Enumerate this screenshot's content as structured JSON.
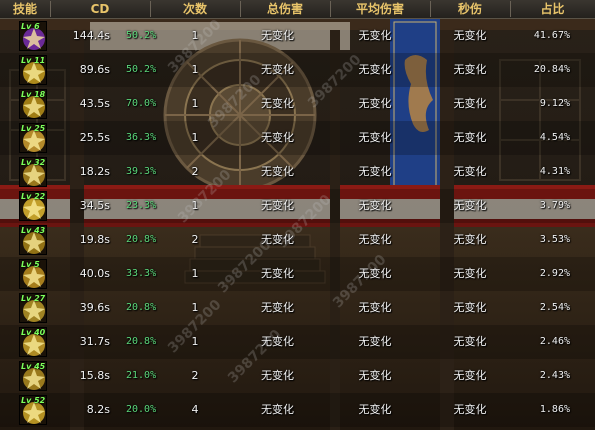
{
  "header": {
    "skill": "技能",
    "cd": "CD",
    "count": "次数",
    "total_damage": "总伤害",
    "avg_damage": "平均伤害",
    "dps": "秒伤",
    "share": "占比"
  },
  "watermark": "3987200",
  "rows": [
    {
      "level": "Lv 6",
      "cd": "144.4s",
      "cd_pct": "50.2%",
      "count": "1",
      "total": "无变化",
      "avg": "无变化",
      "dps": "无变化",
      "share": "41.67%",
      "icon": "purple-blast-icon",
      "color": "#7a2fb0"
    },
    {
      "level": "Lv 11",
      "cd": "89.6s",
      "cd_pct": "50.2%",
      "count": "1",
      "total": "无变化",
      "avg": "无变化",
      "dps": "无变化",
      "share": "20.84%",
      "icon": "golden-arms-icon",
      "color": "#c8a020"
    },
    {
      "level": "Lv 18",
      "cd": "43.5s",
      "cd_pct": "70.0%",
      "count": "1",
      "total": "无变化",
      "avg": "无变化",
      "dps": "无变化",
      "share": "9.12%",
      "icon": "golden-skull-icon",
      "color": "#b89018"
    },
    {
      "level": "Lv 25",
      "cd": "25.5s",
      "cd_pct": "36.3%",
      "count": "1",
      "total": "无变化",
      "avg": "无变化",
      "dps": "无变化",
      "share": "4.54%",
      "icon": "golden-face-icon",
      "color": "#d0a030"
    },
    {
      "level": "Lv 32",
      "cd": "18.2s",
      "cd_pct": "39.3%",
      "count": "2",
      "total": "无变化",
      "avg": "无变化",
      "dps": "无变化",
      "share": "4.31%",
      "icon": "golden-burst-icon",
      "color": "#b08a20"
    },
    {
      "level": "Lv 22",
      "cd": "34.5s",
      "cd_pct": "23.3%",
      "count": "1",
      "total": "无变化",
      "avg": "无变化",
      "dps": "无变化",
      "share": "3.79%",
      "icon": "golden-rays-icon",
      "color": "#e0b830"
    },
    {
      "level": "Lv 43",
      "cd": "19.8s",
      "cd_pct": "20.8%",
      "count": "2",
      "total": "无变化",
      "avg": "无变化",
      "dps": "无变化",
      "share": "3.53%",
      "icon": "golden-slash-icon",
      "color": "#a88418"
    },
    {
      "level": "Lv 5",
      "cd": "40.0s",
      "cd_pct": "33.3%",
      "count": "1",
      "total": "无变化",
      "avg": "无变化",
      "dps": "无变化",
      "share": "2.92%",
      "icon": "golden-strike-icon",
      "color": "#c09020"
    },
    {
      "level": "Lv 27",
      "cd": "39.6s",
      "cd_pct": "20.8%",
      "count": "1",
      "total": "无变化",
      "avg": "无变化",
      "dps": "无变化",
      "share": "2.54%",
      "icon": "golden-wave-icon",
      "color": "#b89828"
    },
    {
      "level": "Lv 40",
      "cd": "31.7s",
      "cd_pct": "20.8%",
      "count": "1",
      "total": "无变化",
      "avg": "无变化",
      "dps": "无变化",
      "share": "2.46%",
      "icon": "golden-flame-icon",
      "color": "#c8a028"
    },
    {
      "level": "Lv 45",
      "cd": "15.8s",
      "cd_pct": "21.0%",
      "count": "2",
      "total": "无变化",
      "avg": "无变化",
      "dps": "无变化",
      "share": "2.43%",
      "icon": "golden-wind-icon",
      "color": "#b08c20"
    },
    {
      "level": "Lv 52",
      "cd": "8.2s",
      "cd_pct": "20.0%",
      "count": "4",
      "total": "无变化",
      "avg": "无变化",
      "dps": "无变化",
      "share": "1.86%",
      "icon": "golden-explosion-icon",
      "color": "#d0a828"
    }
  ]
}
